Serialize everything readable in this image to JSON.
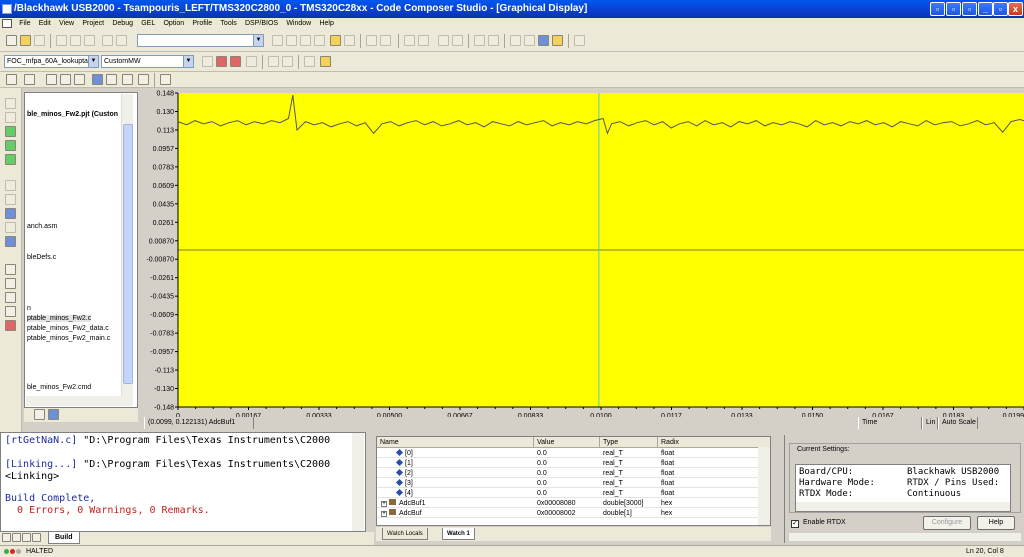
{
  "window": {
    "title": "/Blackhawk USB2000 - Tsampouris_LEFT/TMS320C2800_0 - TMS320C28xx - Code Composer Studio - [Graphical Display]",
    "controls": [
      "_",
      "▫",
      "x"
    ]
  },
  "menu": [
    "File",
    "Edit",
    "View",
    "Project",
    "Debug",
    "GEL",
    "Option",
    "Profile",
    "Tools",
    "DSP/BIOS",
    "Window",
    "Help"
  ],
  "toolbar2": {
    "project_combo": "FOC_mfpa_60A_lookuptal",
    "config_combo": "CustomMW"
  },
  "project_tree": {
    "items": [
      "ble_minos_Fw2.pjt (Custon",
      "anch.asm",
      "bleDefs.c",
      "n",
      "ptable_minos_Fw2.c",
      "ptable_minos_Fw2_data.c",
      "ptable_minos_Fw2_main.c",
      "ble_minos_Fw2.cmd"
    ]
  },
  "graph": {
    "cursor_readout": "(0.0099, 0.122131) AdcBuf1",
    "x_unit": "Time",
    "scale": "Lin",
    "autoscale": "Auto Scale",
    "background": "#ffff00",
    "trace_color": "#555555"
  },
  "chart_data": {
    "type": "line",
    "series": [
      {
        "name": "AdcBuf1",
        "x": [
          0,
          0.0002,
          0.0004,
          0.0006,
          0.0008,
          0.001,
          0.0012,
          0.0014,
          0.0016,
          0.0018,
          0.002,
          0.0022,
          0.0024,
          0.0026,
          0.0027,
          0.0028,
          0.003,
          0.0032,
          0.0034,
          0.0036,
          0.0038,
          0.004,
          0.0042,
          0.0044,
          0.0046,
          0.0048,
          0.005,
          0.0052,
          0.0054,
          0.0056,
          0.0058,
          0.006,
          0.0062,
          0.0064,
          0.0066,
          0.0068,
          0.007,
          0.0072,
          0.0074,
          0.0076,
          0.0078,
          0.008,
          0.0082,
          0.0084,
          0.0086,
          0.0088,
          0.009,
          0.0092,
          0.0094,
          0.0096,
          0.0098,
          0.01,
          0.0101,
          0.0102,
          0.0104,
          0.0106,
          0.0108,
          0.011,
          0.0112,
          0.0114,
          0.0116,
          0.0118,
          0.012,
          0.0122,
          0.0124,
          0.0126,
          0.0128,
          0.013,
          0.0132,
          0.0134,
          0.0136,
          0.0138,
          0.014,
          0.0142,
          0.0144,
          0.0146,
          0.0148,
          0.015,
          0.0152,
          0.0154,
          0.0156,
          0.0158,
          0.016,
          0.0162,
          0.0164,
          0.0166,
          0.0168,
          0.017,
          0.0172,
          0.0174,
          0.0176,
          0.0178,
          0.018,
          0.0182,
          0.0184,
          0.0186,
          0.0188,
          0.019,
          0.0192,
          0.0194,
          0.0196,
          0.0198,
          0.0199
        ],
        "y": [
          0.121,
          0.118,
          0.122,
          0.119,
          0.121,
          0.117,
          0.12,
          0.122,
          0.118,
          0.121,
          0.119,
          0.122,
          0.12,
          0.124,
          0.146,
          0.113,
          0.121,
          0.118,
          0.12,
          0.116,
          0.119,
          0.121,
          0.117,
          0.12,
          0.11,
          0.119,
          0.121,
          0.117,
          0.12,
          0.122,
          0.118,
          0.121,
          0.117,
          0.119,
          0.122,
          0.118,
          0.12,
          0.116,
          0.121,
          0.119,
          0.117,
          0.121,
          0.118,
          0.12,
          0.122,
          0.117,
          0.12,
          0.118,
          0.121,
          0.119,
          0.122,
          0.124,
          0.11,
          0.119,
          0.121,
          0.117,
          0.12,
          0.122,
          0.118,
          0.121,
          0.115,
          0.119,
          0.121,
          0.117,
          0.122,
          0.118,
          0.12,
          0.116,
          0.121,
          0.119,
          0.122,
          0.117,
          0.12,
          0.118,
          0.121,
          0.119,
          0.116,
          0.122,
          0.118,
          0.12,
          0.117,
          0.121,
          0.119,
          0.122,
          0.118,
          0.12,
          0.116,
          0.121,
          0.119,
          0.117,
          0.122,
          0.118,
          0.12,
          0.121,
          0.117,
          0.119,
          0.122,
          0.118,
          0.12,
          0.111,
          0.121,
          0.123,
          0.122
        ]
      }
    ],
    "xlim": [
      0,
      0.0199
    ],
    "ylim": [
      -0.148,
      0.148
    ],
    "x_ticks": [
      "0",
      "0.00167",
      "0.00333",
      "0.00500",
      "0.00667",
      "0.00833",
      "0.0100",
      "0.0117",
      "0.0133",
      "0.0150",
      "0.0167",
      "0.0183",
      "0.0199"
    ],
    "y_ticks": [
      "0.148",
      "0.130",
      "0.113",
      "0.0957",
      "0.0783",
      "0.0609",
      "0.0435",
      "0.0261",
      "0.00870",
      "-0.00870",
      "-0.0261",
      "-0.0435",
      "-0.0609",
      "-0.0783",
      "-0.0957",
      "-0.113",
      "-0.130",
      "-0.148"
    ],
    "cursor_x": 0.0099,
    "grid": false
  },
  "build_output": {
    "lines": [
      {
        "tag": "[rtGetNaN.c]",
        "text": " \"D:\\Program Files\\Texas Instruments\\C2000"
      },
      {
        "tag": "[Linking...]",
        "text": " \"D:\\Program Files\\Texas Instruments\\C2000"
      },
      {
        "tag": "",
        "text": "<Linking>"
      },
      {
        "tag": "",
        "text": "Build Complete,"
      },
      {
        "tag": "",
        "text": "  0 Errors, 0 Warnings, 0 Remarks."
      }
    ],
    "tab": "Build"
  },
  "watch": {
    "headers": [
      "Name",
      "Value",
      "Type",
      "Radix"
    ],
    "rows": [
      {
        "name": "[0]",
        "value": "0.0",
        "type": "real_T",
        "radix": "float",
        "kind": "elem"
      },
      {
        "name": "[1]",
        "value": "0.0",
        "type": "real_T",
        "radix": "float",
        "kind": "elem"
      },
      {
        "name": "[2]",
        "value": "0.0",
        "type": "real_T",
        "radix": "float",
        "kind": "elem"
      },
      {
        "name": "[3]",
        "value": "0.0",
        "type": "real_T",
        "radix": "float",
        "kind": "elem"
      },
      {
        "name": "[4]",
        "value": "0.0",
        "type": "real_T",
        "radix": "float",
        "kind": "elem"
      },
      {
        "name": "AdcBuf1",
        "value": "0x00008080",
        "type": "double[3000]",
        "radix": "hex",
        "kind": "var"
      },
      {
        "name": "AdcBuf",
        "value": "0x00008002",
        "type": "double[1]",
        "radix": "hex",
        "kind": "var"
      }
    ],
    "tabs": [
      "Watch Locals",
      "Watch 1"
    ]
  },
  "rtdx": {
    "group_label": "Current Settings:",
    "settings": [
      {
        "k": "Board/CPU:",
        "v": "Blackhawk USB2000"
      },
      {
        "k": "Hardware Mode:",
        "v": "RTDX / Pins Used:"
      },
      {
        "k": "RTDX Mode:",
        "v": "Continuous"
      }
    ],
    "enable_label": "Enable RTDX",
    "configure_label": "Configure",
    "help_label": "Help"
  },
  "status": {
    "state": "HALTED",
    "position": "Ln 20, Col 8"
  }
}
